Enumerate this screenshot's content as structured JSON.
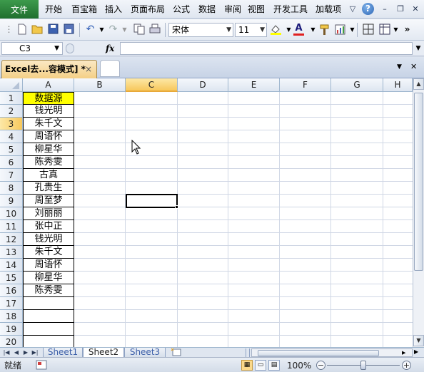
{
  "menubar": {
    "file": "文件",
    "items": [
      "开始",
      "百宝箱",
      "插入",
      "页面布局",
      "公式",
      "数据",
      "审阅",
      "视图",
      "开发工具",
      "加载项"
    ],
    "help_glyph": "?",
    "icons": [
      "ribbon-toggle-icon",
      "help-icon",
      "minimize-icon",
      "restore-icon",
      "close-icon"
    ]
  },
  "toolbar": {
    "font_name": "宋体",
    "font_size": "11",
    "font_color_label": "A",
    "overflow": "»"
  },
  "formulabar": {
    "cell_ref": "C3",
    "fx": "fx",
    "formula": ""
  },
  "workbook_tab": {
    "label": "Excel去...容模式] *",
    "close": "×"
  },
  "columns": [
    "A",
    "B",
    "C",
    "D",
    "E",
    "F",
    "G",
    "H"
  ],
  "rows": [
    "1",
    "2",
    "3",
    "4",
    "5",
    "6",
    "7",
    "8",
    "9",
    "10",
    "11",
    "12",
    "13",
    "14",
    "15",
    "16",
    "17",
    "18",
    "19",
    "20"
  ],
  "selected_cell": {
    "col": "C",
    "row": "3"
  },
  "column_a": [
    "数据源",
    "钱光明",
    "朱千文",
    "周语怀",
    "柳星华",
    "陈秀雯",
    "古真",
    "孔贵生",
    "周至梦",
    "刘丽丽",
    "张中正",
    "钱光明",
    "朱千文",
    "周语怀",
    "柳星华",
    "陈秀雯",
    "",
    "",
    "",
    ""
  ],
  "header_cell_color": "#ffff00",
  "sheets": [
    "Sheet1",
    "Sheet2",
    "Sheet3"
  ],
  "active_sheet": "Sheet2",
  "statusbar": {
    "ready": "就绪",
    "zoom": "100%",
    "zoom_level": 1.0
  }
}
